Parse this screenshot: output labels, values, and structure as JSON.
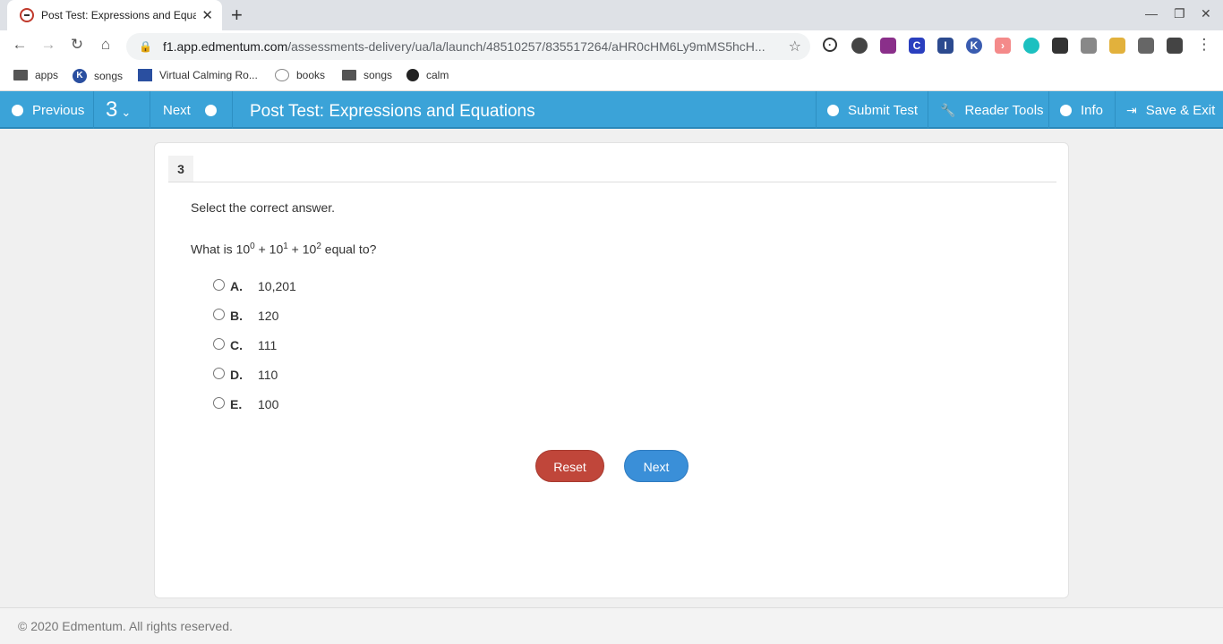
{
  "browser": {
    "tab_title": "Post Test: Expressions and Equa",
    "url_host": "f1.app.edmentum.com",
    "url_path": "/assessments-delivery/ua/la/launch/48510257/835517264/aHR0cHM6Ly9mMS5hcH...",
    "bookmarks": [
      "apps",
      "songs",
      "Virtual Calming Ro...",
      "books",
      "songs",
      "calm"
    ]
  },
  "appbar": {
    "previous": "Previous",
    "question_number": "3",
    "next": "Next",
    "title": "Post Test: Expressions and Equations",
    "submit": "Submit Test",
    "reader_tools": "Reader Tools",
    "info": "Info",
    "save_exit": "Save & Exit"
  },
  "question": {
    "number": "3",
    "instruction": "Select the correct answer.",
    "prompt_prefix": "What is 10",
    "exp1": "0",
    "mid1": " + 10",
    "exp2": "1",
    "mid2": " + 10",
    "exp3": "2",
    "prompt_suffix": " equal to?",
    "choices": [
      {
        "letter": "A.",
        "text": "10,201"
      },
      {
        "letter": "B.",
        "text": "120"
      },
      {
        "letter": "C.",
        "text": "111"
      },
      {
        "letter": "D.",
        "text": "110"
      },
      {
        "letter": "E.",
        "text": "100"
      }
    ]
  },
  "buttons": {
    "reset": "Reset",
    "next": "Next"
  },
  "footer": "© 2020 Edmentum. All rights reserved.",
  "colors": {
    "appbar": "#3ba3d8",
    "reset": "#c0463a",
    "next": "#3a8fd8"
  }
}
